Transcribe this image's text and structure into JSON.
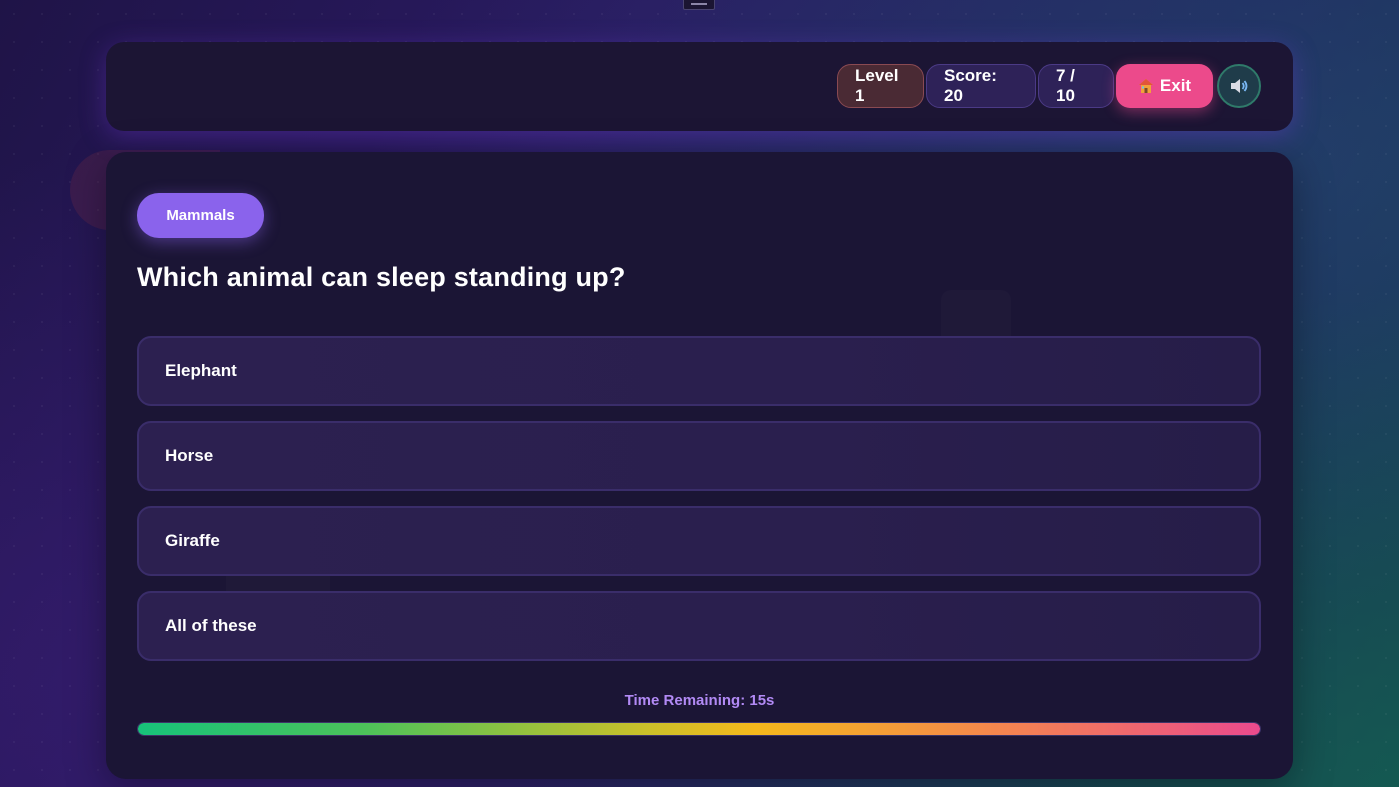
{
  "header": {
    "level": "Level 1",
    "score": "Score: 20",
    "progress": "7 / 10",
    "exit_label": "Exit"
  },
  "quiz": {
    "category": "Mammals",
    "question": "Which animal can sleep standing up?",
    "answers": [
      "Elephant",
      "Horse",
      "Giraffe",
      "All of these"
    ]
  },
  "timer": {
    "label": "Time Remaining: 15s",
    "fraction": 1.0
  },
  "colors": {
    "accent": "#8a63ec",
    "exit": "#ec4a8b"
  },
  "icons": {
    "exit": "house-icon",
    "sound": "speaker-icon",
    "handle": "drag-handle-icon"
  }
}
